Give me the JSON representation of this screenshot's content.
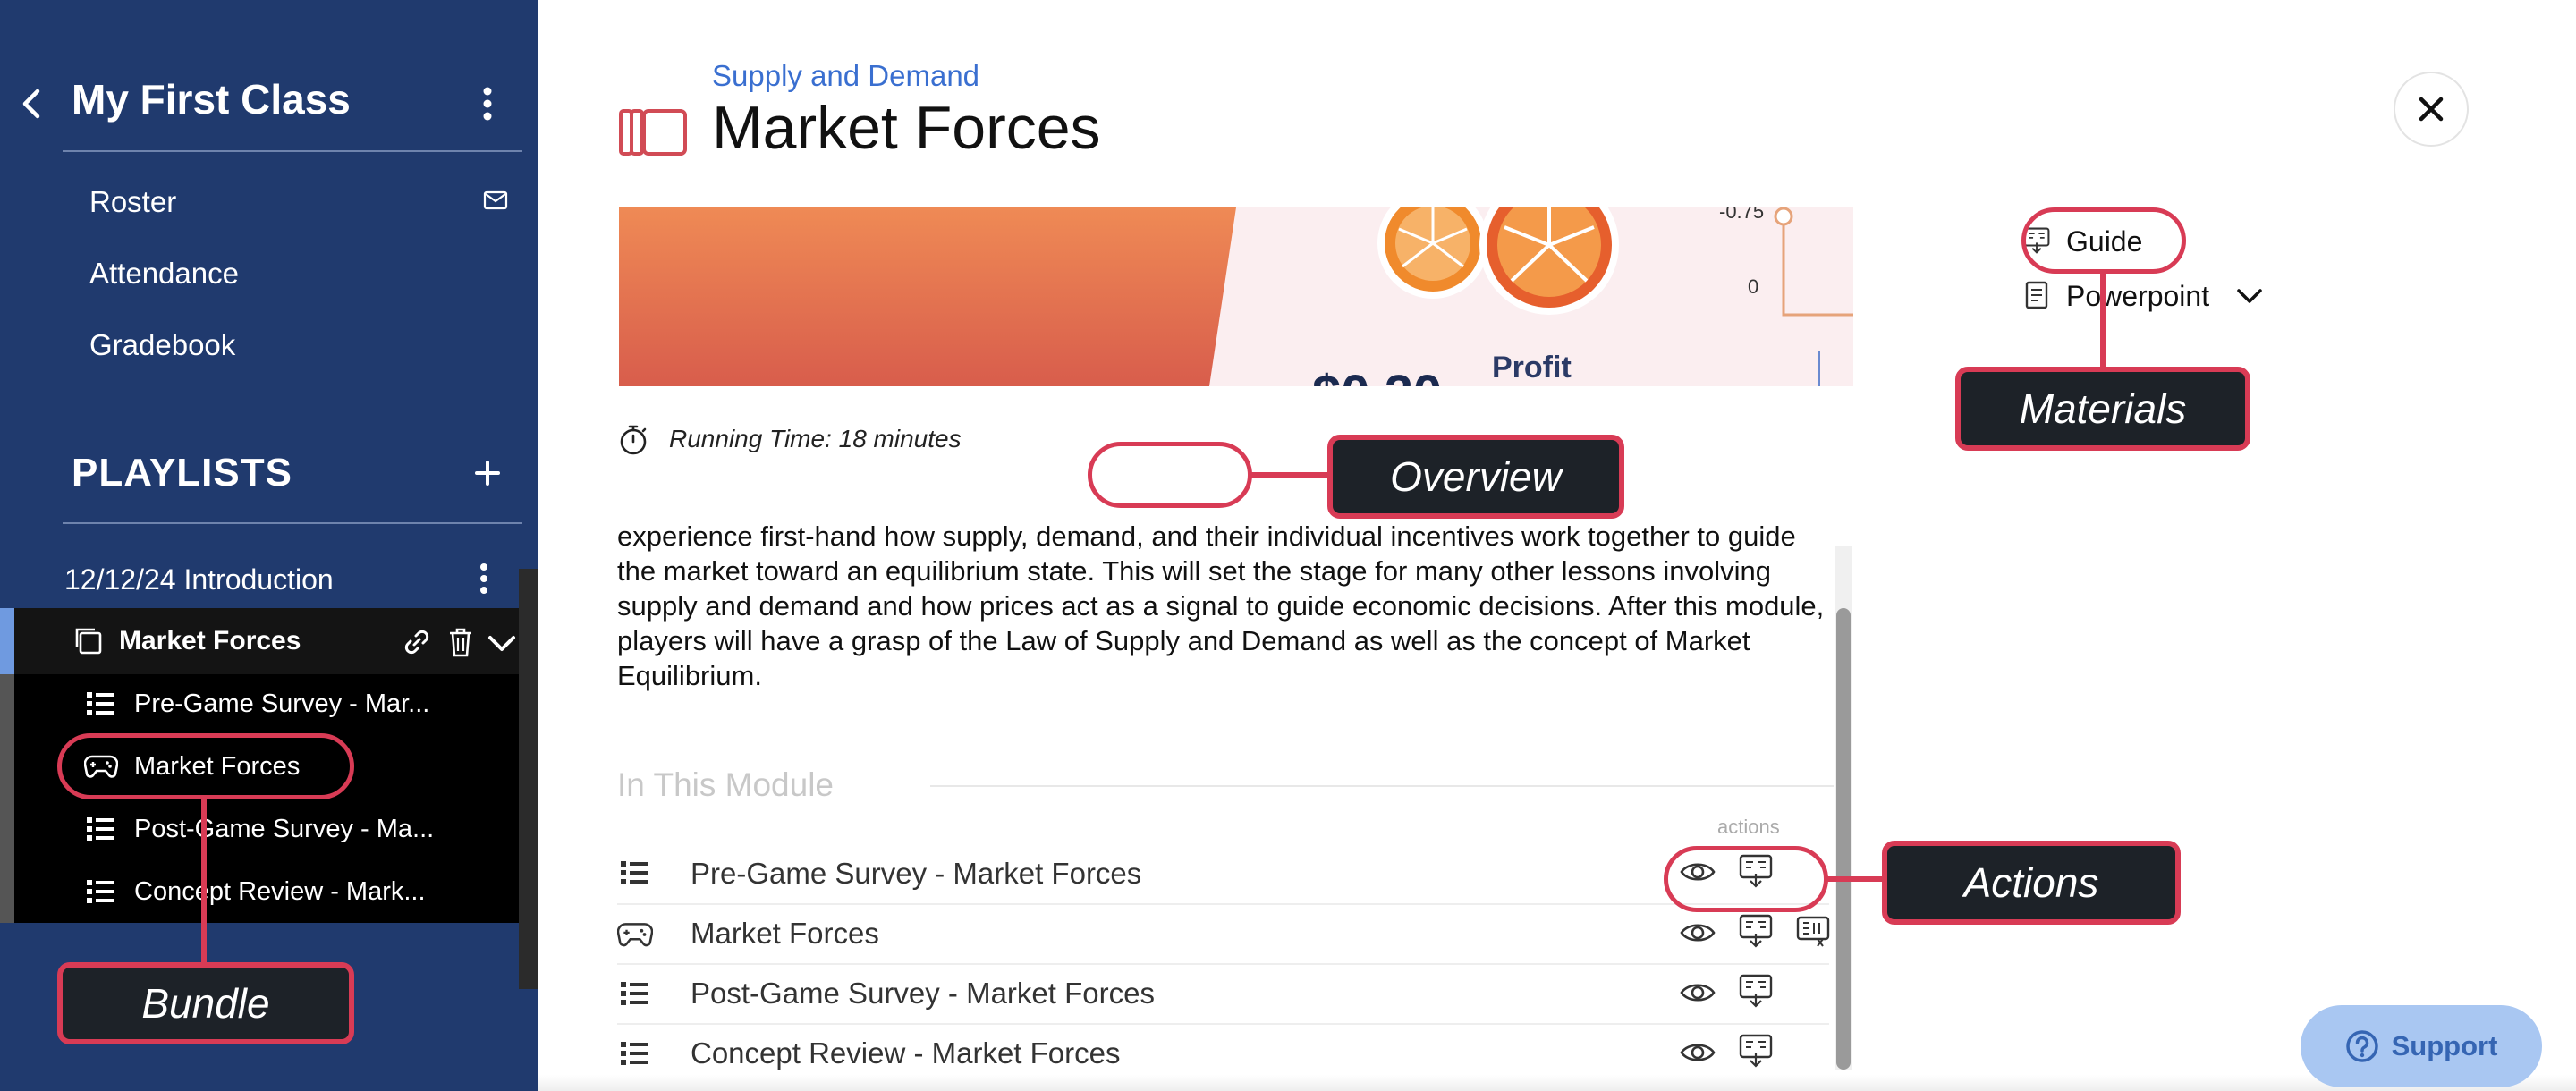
{
  "sidebar": {
    "class_title": "My First Class",
    "links": [
      "Roster",
      "Attendance",
      "Gradebook"
    ],
    "playlists_heading": "PLAYLISTS",
    "playlist_name": "12/12/24 Introduction",
    "bundle_name": "Market Forces",
    "items": [
      {
        "label": "Pre-Game Survey - Mar...",
        "icon": "list-icon"
      },
      {
        "label": "Market Forces",
        "icon": "gamepad-icon"
      },
      {
        "label": "Post-Game Survey - Ma...",
        "icon": "list-icon"
      },
      {
        "label": "Concept Review - Mark...",
        "icon": "list-icon"
      }
    ]
  },
  "header": {
    "breadcrumb": "Supply and Demand",
    "title": "Market Forces"
  },
  "banner": {
    "axis_top": "-0.75",
    "axis_zero": "0",
    "profit_label": "Profit",
    "price_partial": "$0.20"
  },
  "overview": {
    "running_time": "Running Time: 18 minutes",
    "text": "experience first-hand how supply, demand, and their individual incentives work together to guide the market toward an equilibrium state. This will set the stage for many other lessons involving supply and demand and how prices act as a signal to guide economic decisions. After this module, players will have a grasp of the Law of Supply and Demand as well as the concept of Market Equilibrium."
  },
  "module": {
    "heading": "In This Module",
    "actions_label": "actions",
    "rows": [
      {
        "title": "Pre-Game Survey - Market Forces",
        "icon": "list-icon",
        "extra_action": false
      },
      {
        "title": "Market Forces",
        "icon": "gamepad-icon",
        "extra_action": true
      },
      {
        "title": "Post-Game Survey - Market Forces",
        "icon": "list-icon",
        "extra_action": false
      },
      {
        "title": "Concept Review - Market Forces",
        "icon": "list-icon",
        "extra_action": false
      }
    ]
  },
  "materials": {
    "guide": "Guide",
    "powerpoint": "Powerpoint"
  },
  "callouts": {
    "materials": "Materials",
    "overview": "Overview",
    "actions": "Actions",
    "bundle": "Bundle"
  },
  "support": {
    "label": "Support"
  },
  "colors": {
    "sidebar": "#203a6e",
    "accent_red": "#d83b55",
    "link_blue": "#3a6fd0",
    "callout_bg": "#1d2228"
  }
}
